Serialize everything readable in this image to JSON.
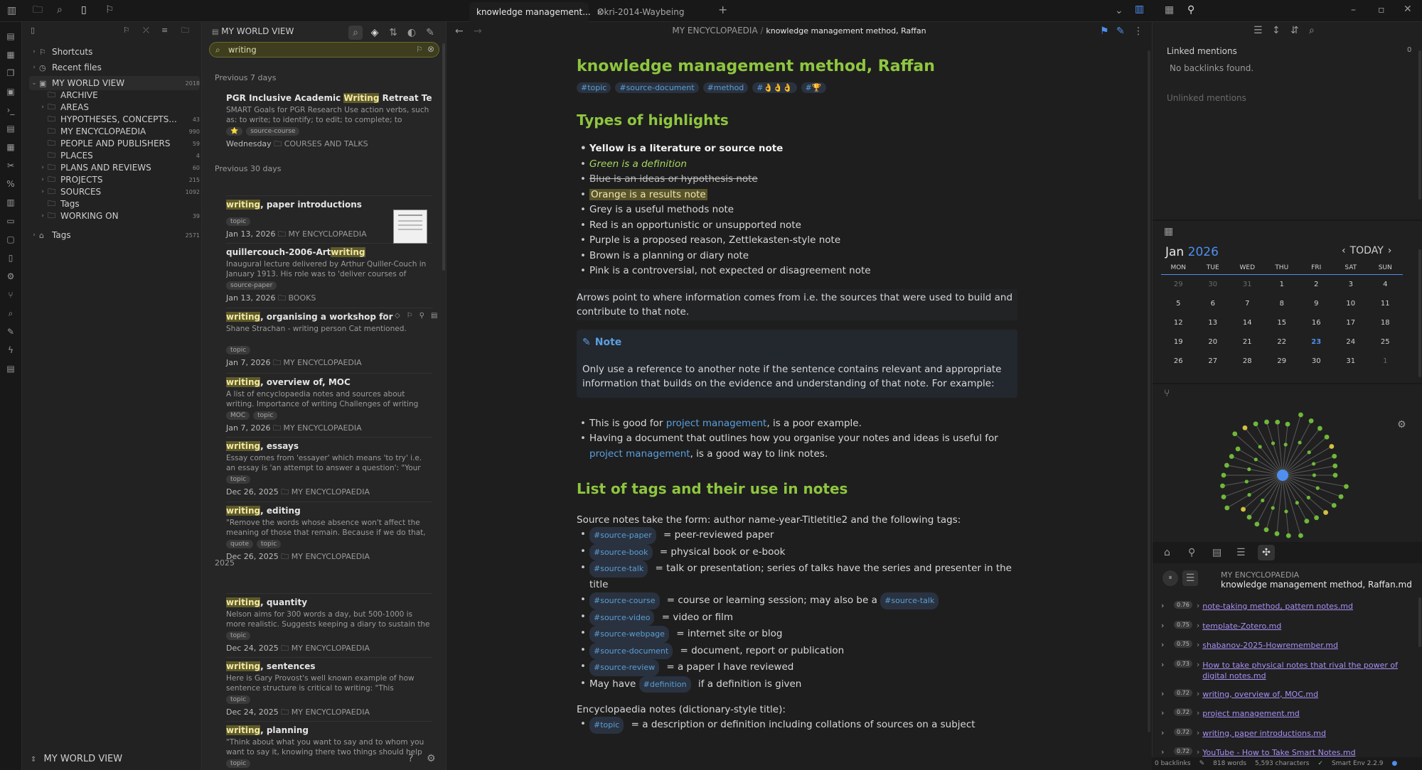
{
  "tabs": [
    {
      "label": "knowledge management...",
      "active": true
    },
    {
      "label": "Okri-2014-Waybeing",
      "active": false
    }
  ],
  "sidebar": {
    "items": [
      {
        "label": "Shortcuts",
        "count": "",
        "icon": "bookmark-icon"
      },
      {
        "label": "Recent files",
        "count": "",
        "icon": "clock-icon"
      },
      {
        "label": "MY WORLD VIEW",
        "count": "2018",
        "icon": "vault-icon"
      },
      {
        "label": "ARCHIVE",
        "count": ""
      },
      {
        "label": "AREAS",
        "count": ""
      },
      {
        "label": "HYPOTHESES, CONCEPTS...",
        "count": "43"
      },
      {
        "label": "MY ENCYCLOPAEDIA",
        "count": "990"
      },
      {
        "label": "PEOPLE AND PUBLISHERS",
        "count": "59"
      },
      {
        "label": "PLACES",
        "count": "4"
      },
      {
        "label": "PLANS AND REVIEWS",
        "count": "60"
      },
      {
        "label": "PROJECTS",
        "count": "215"
      },
      {
        "label": "SOURCES",
        "count": "1092"
      },
      {
        "label": "Tags",
        "count": ""
      },
      {
        "label": "WORKING ON",
        "count": "39"
      },
      {
        "label": "Tags",
        "count": "2571"
      }
    ],
    "vault": "MY WORLD VIEW"
  },
  "notes_panel": {
    "title": "MY WORLD VIEW",
    "search": "writing",
    "section_7": "Previous 7 days",
    "section_30": "Previous 30 days",
    "section_2025": "2025",
    "notes": [
      {
        "pre": "PGR Inclusive Academic ",
        "hl": "Writing",
        "post": " Retreat Template",
        "snip": "SMART Goals for PGR Research Use action verbs, such as: to write; to identify; to edit; to complete; to presen...",
        "tags": [
          "⭐",
          "source-course"
        ],
        "date": "Wednesday",
        "folder": "COURSES AND TALKS"
      },
      {
        "pre": "",
        "hl": "writing",
        "post": ", paper introductions",
        "snip": "",
        "tags": [
          "topic"
        ],
        "date": "Jan 13, 2026",
        "folder": "MY ENCYCLOPAEDIA"
      },
      {
        "pre": "quillercouch-2006-Art",
        "hl": "writing",
        "post": "",
        "snip": "Inaugural lecture delivered by Arthur Quiller-Couch in January 1913. His role was to 'deliver courses of lecture...",
        "tags": [
          "source-paper"
        ],
        "date": "Jan 13, 2026",
        "folder": "BOOKS"
      },
      {
        "pre": "",
        "hl": "writing",
        "post": ", organising a workshop for",
        "snip": "Shane Strachan - writing person Cat mentioned.",
        "tags": [
          "topic"
        ],
        "date": "Jan 7, 2026",
        "folder": "MY ENCYCLOPAEDIA"
      },
      {
        "pre": "",
        "hl": "writing",
        "post": ", overview of, MOC",
        "snip": "A list of encyclopaedia notes and sources about writing. Importance of writing Challenges of writing Planning...",
        "tags": [
          "MOC",
          "topic"
        ],
        "date": "Jan 7, 2026",
        "folder": "MY ENCYCLOPAEDIA"
      },
      {
        "pre": "",
        "hl": "writing",
        "post": ", essays",
        "snip": "Essay comes from 'essayer' which means 'to try' i.e. an essay is 'an attempt to answer a question': \"Your attemp...",
        "tags": [
          "topic"
        ],
        "date": "Dec 26, 2025",
        "folder": "MY ENCYCLOPAEDIA"
      },
      {
        "pre": "",
        "hl": "writing",
        "post": ", editing",
        "snip": "\"Remove the words whose absence won't affect the meaning of those that remain. Because if we do that, t...",
        "tags": [
          "quote",
          "topic"
        ],
        "date": "Dec 26, 2025",
        "folder": "MY ENCYCLOPAEDIA"
      },
      {
        "pre": "",
        "hl": "writing",
        "post": ", quantity",
        "snip": "Nelson aims for 300 words a day, but 500-1000 is more realistic. Suggests keeping a diary to sustain the writing...",
        "tags": [
          "topic"
        ],
        "date": "Dec 24, 2025",
        "folder": "MY ENCYCLOPAEDIA"
      },
      {
        "pre": "",
        "hl": "writing",
        "post": ", sentences",
        "snip": "Here is Gary Provost's well known example of how sentence structure is critical to writing: \"This sentence...",
        "tags": [
          "topic"
        ],
        "date": "Dec 24, 2025",
        "folder": "MY ENCYCLOPAEDIA"
      },
      {
        "pre": "",
        "hl": "writing",
        "post": ", planning",
        "snip": "\"Think about what you want to say and to whom you want to say it, knowing there two things should help yo...",
        "tags": [
          "topic"
        ],
        "date": "",
        "folder": ""
      }
    ]
  },
  "editor": {
    "breadcrumb_folder": "MY ENCYCLOPAEDIA",
    "breadcrumb_sep": "/",
    "breadcrumb_file": "knowledge management method, Raffan",
    "title": "knowledge management method, Raffan",
    "tags": [
      "#topic",
      "#source-document",
      "#method",
      "#👌👌👌",
      "#🏆"
    ],
    "h_types": "Types of highlights",
    "types": [
      "Yellow is a literature or source note",
      "Green is a definition",
      "Blue is an ideas or hypothesis note",
      "Orange is a results note",
      "Grey is a useful methods note",
      "Red is an opportunistic or unsupported note",
      "Purple is a proposed reason, Zettlekasten-style note",
      "Brown is a planning or diary note",
      "Pink is a controversial, not expected or disagreement note"
    ],
    "arrows": "Arrows point to where information comes from i.e. the sources that were used to build and contribute to that note.",
    "callout_title": "Note",
    "callout_body": "Only use a reference to another note if the sentence contains relevant and appropriate information that builds on the evidence and understanding of that note. For example:",
    "ex1_a": "This is good for ",
    "ex1_link": "project management",
    "ex1_b": ", is a poor example.",
    "ex2_a": "Having a document that outlines how you organise your notes and ideas is useful for ",
    "ex2_link": "project management",
    "ex2_b": ", is a good way to link notes.",
    "h_tags": "List of tags and their use in notes",
    "source_intro": "Source notes take the form: author name-year-Titletitle2 and the following tags:",
    "tag_list": [
      {
        "tag": "#source-paper",
        "desc": " = peer-reviewed paper"
      },
      {
        "tag": "#source-book",
        "desc": " = physical book or e-book"
      },
      {
        "tag": "#source-talk",
        "desc": " = talk or presentation; series of talks have the series and presenter in the title"
      },
      {
        "tag": "#source-course",
        "desc": " = course or learning session; may also be a "
      },
      {
        "tag": "#source-video",
        "desc": " = video or film"
      },
      {
        "tag": "#source-webpage",
        "desc": " = internet site or blog"
      },
      {
        "tag": "#source-document",
        "desc": " = document, report or publication"
      },
      {
        "tag": "#source-review",
        "desc": " = a paper I have reviewed"
      }
    ],
    "course_extra": "#source-talk",
    "may_have": "May have ",
    "def_tag": "#definition",
    "def_tail": " if a definition is given",
    "ency_intro": "Encyclopaedia notes (dictionary-style title):",
    "ency_tag": "#topic",
    "ency_desc": " = a description or definition including collations of sources on a subject"
  },
  "right": {
    "linked": "Linked mentions",
    "linked_count": "0",
    "no_backlinks": "No backlinks found.",
    "unlinked": "Unlinked mentions",
    "cal_month": "Jan",
    "cal_year": "2026",
    "cal_today": "TODAY",
    "weekdays": [
      "MON",
      "TUE",
      "WED",
      "THU",
      "FRI",
      "SAT",
      "SUN"
    ],
    "weeks": [
      [
        "29",
        "30",
        "31",
        "1",
        "2",
        "3",
        "4"
      ],
      [
        "5",
        "6",
        "7",
        "8",
        "9",
        "10",
        "11"
      ],
      [
        "12",
        "13",
        "14",
        "15",
        "16",
        "17",
        "18"
      ],
      [
        "19",
        "20",
        "21",
        "22",
        "23",
        "24",
        "25"
      ],
      [
        "26",
        "27",
        "28",
        "29",
        "30",
        "31",
        "1"
      ]
    ],
    "sc_folder": "MY ENCYCLOPAEDIA",
    "sc_file": "knowledge management method, Raffan.md",
    "results": [
      {
        "score": "0.76",
        "name": "note-taking method, pattern notes.md"
      },
      {
        "score": "0.75",
        "name": "template-Zotero.md"
      },
      {
        "score": "0.75",
        "name": "shabanov-2025-Howremember.md"
      },
      {
        "score": "0.73",
        "name": "How to take physical notes that rival the power of digital notes.md"
      },
      {
        "score": "0.72",
        "name": "writing, overview of, MOC.md"
      },
      {
        "score": "0.72",
        "name": "project management.md"
      },
      {
        "score": "0.72",
        "name": "writing, paper introductions.md"
      },
      {
        "score": "0.72",
        "name": "YouTube - How to Take Smart Notes.md"
      }
    ]
  },
  "status": {
    "backlinks": "0 backlinks",
    "words": "818 words",
    "chars": "5,593 characters",
    "env": "Smart Env 2.2.9"
  },
  "colors": {
    "accent": "#8ec63f",
    "link": "#5aa0e0",
    "highlight": "#5f5a2a",
    "purple_link": "#a98ff5",
    "today": "#4f8ff0"
  }
}
